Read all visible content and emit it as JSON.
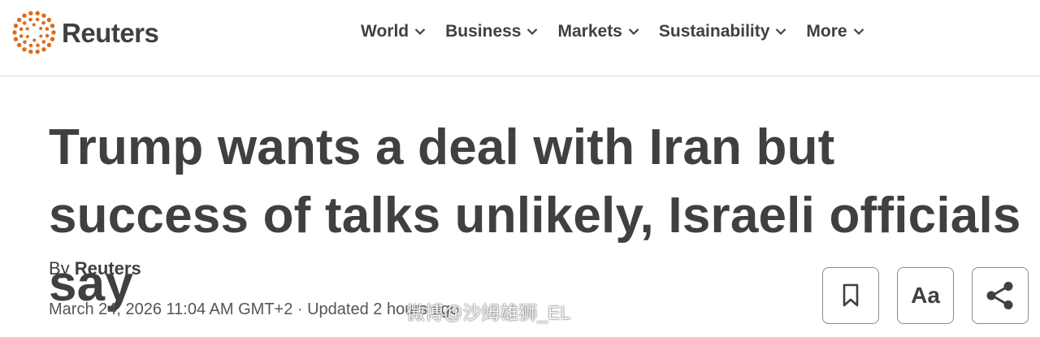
{
  "brand": {
    "name": "Reuters",
    "logo_color": "#e06a1b"
  },
  "nav": {
    "items": [
      {
        "label": "World",
        "icon": "chevron-down-icon"
      },
      {
        "label": "Business",
        "icon": "chevron-down-icon"
      },
      {
        "label": "Markets",
        "icon": "chevron-down-icon"
      },
      {
        "label": "Sustainability",
        "icon": "chevron-down-icon"
      },
      {
        "label": "More",
        "icon": "chevron-down-icon"
      }
    ]
  },
  "article": {
    "headline": "Trump wants a deal with Iran but success of talks unlikely, Israeli officials say",
    "byline_prefix": "By ",
    "author": "Reuters",
    "dateline": "March 24, 2026 11:04 AM GMT+2 · Updated 2 hours ago"
  },
  "tools": {
    "bookmark_icon": "bookmark-icon",
    "text_size_label": "Aa",
    "share_icon": "share-icon"
  },
  "watermark": "微博@沙姆雄狮_EL",
  "colors": {
    "text": "#404040",
    "divider": "#d9d9d9",
    "border": "#8a8a8a"
  }
}
